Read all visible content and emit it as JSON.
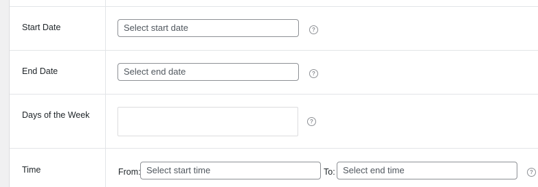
{
  "rows": {
    "start_date": {
      "label": "Start Date",
      "placeholder": "Select start date"
    },
    "end_date": {
      "label": "End Date",
      "placeholder": "Select end date"
    },
    "days_of_week": {
      "label": "Days of the Week"
    },
    "time": {
      "label": "Time",
      "from_label": "From:",
      "from_placeholder": "Select start time",
      "to_label": "To:",
      "to_placeholder": "Select end time"
    }
  },
  "help_icon": {
    "glyph": "?",
    "icon": "help-circle-icon"
  }
}
